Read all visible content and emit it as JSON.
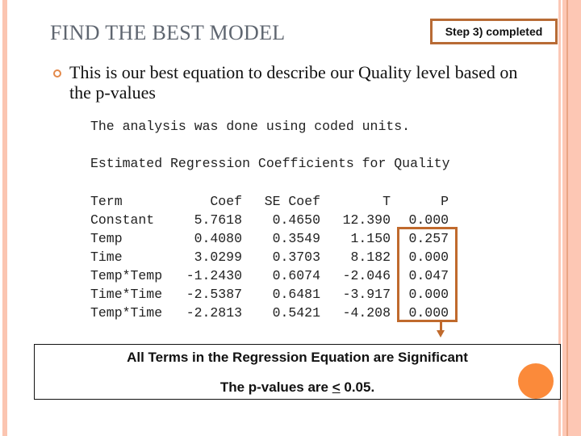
{
  "slide": {
    "title": "FIND THE BEST MODEL",
    "step_badge": "Step 3) completed",
    "bullet_text": "This is our best equation to describe our Quality level based on the p-values"
  },
  "output": {
    "analysis_note": "The analysis was done using coded units.",
    "coefficients_title": "Estimated Regression Coefficients for Quality",
    "table": {
      "columns": [
        "Term",
        "Coef",
        "SE Coef",
        "T",
        "P"
      ],
      "rows": [
        [
          "Constant",
          "5.7618",
          "0.4650",
          "12.390",
          "0.000"
        ],
        [
          "Temp",
          "0.4080",
          "0.3549",
          "1.150",
          "0.257"
        ],
        [
          "Time",
          "3.0299",
          "0.3703",
          "8.182",
          "0.000"
        ],
        [
          "Temp*Temp",
          "-1.2430",
          "0.6074",
          "-2.046",
          "0.047"
        ],
        [
          "Time*Time",
          "-2.5387",
          "0.6481",
          "-3.917",
          "0.000"
        ],
        [
          "Temp*Time",
          "-2.2813",
          "0.5421",
          "-4.208",
          "0.000"
        ]
      ]
    }
  },
  "conclusion": {
    "line1": "All Terms in the Regression Equation are Significant",
    "line2_prefix": "The p-values are ",
    "line2_symbol": "<",
    "line2_suffix": " 0.05."
  },
  "colors": {
    "accent_orange": "#c06a2d",
    "dot_orange": "#fb8a3a",
    "stripe_pink": "#fdc7b4"
  }
}
